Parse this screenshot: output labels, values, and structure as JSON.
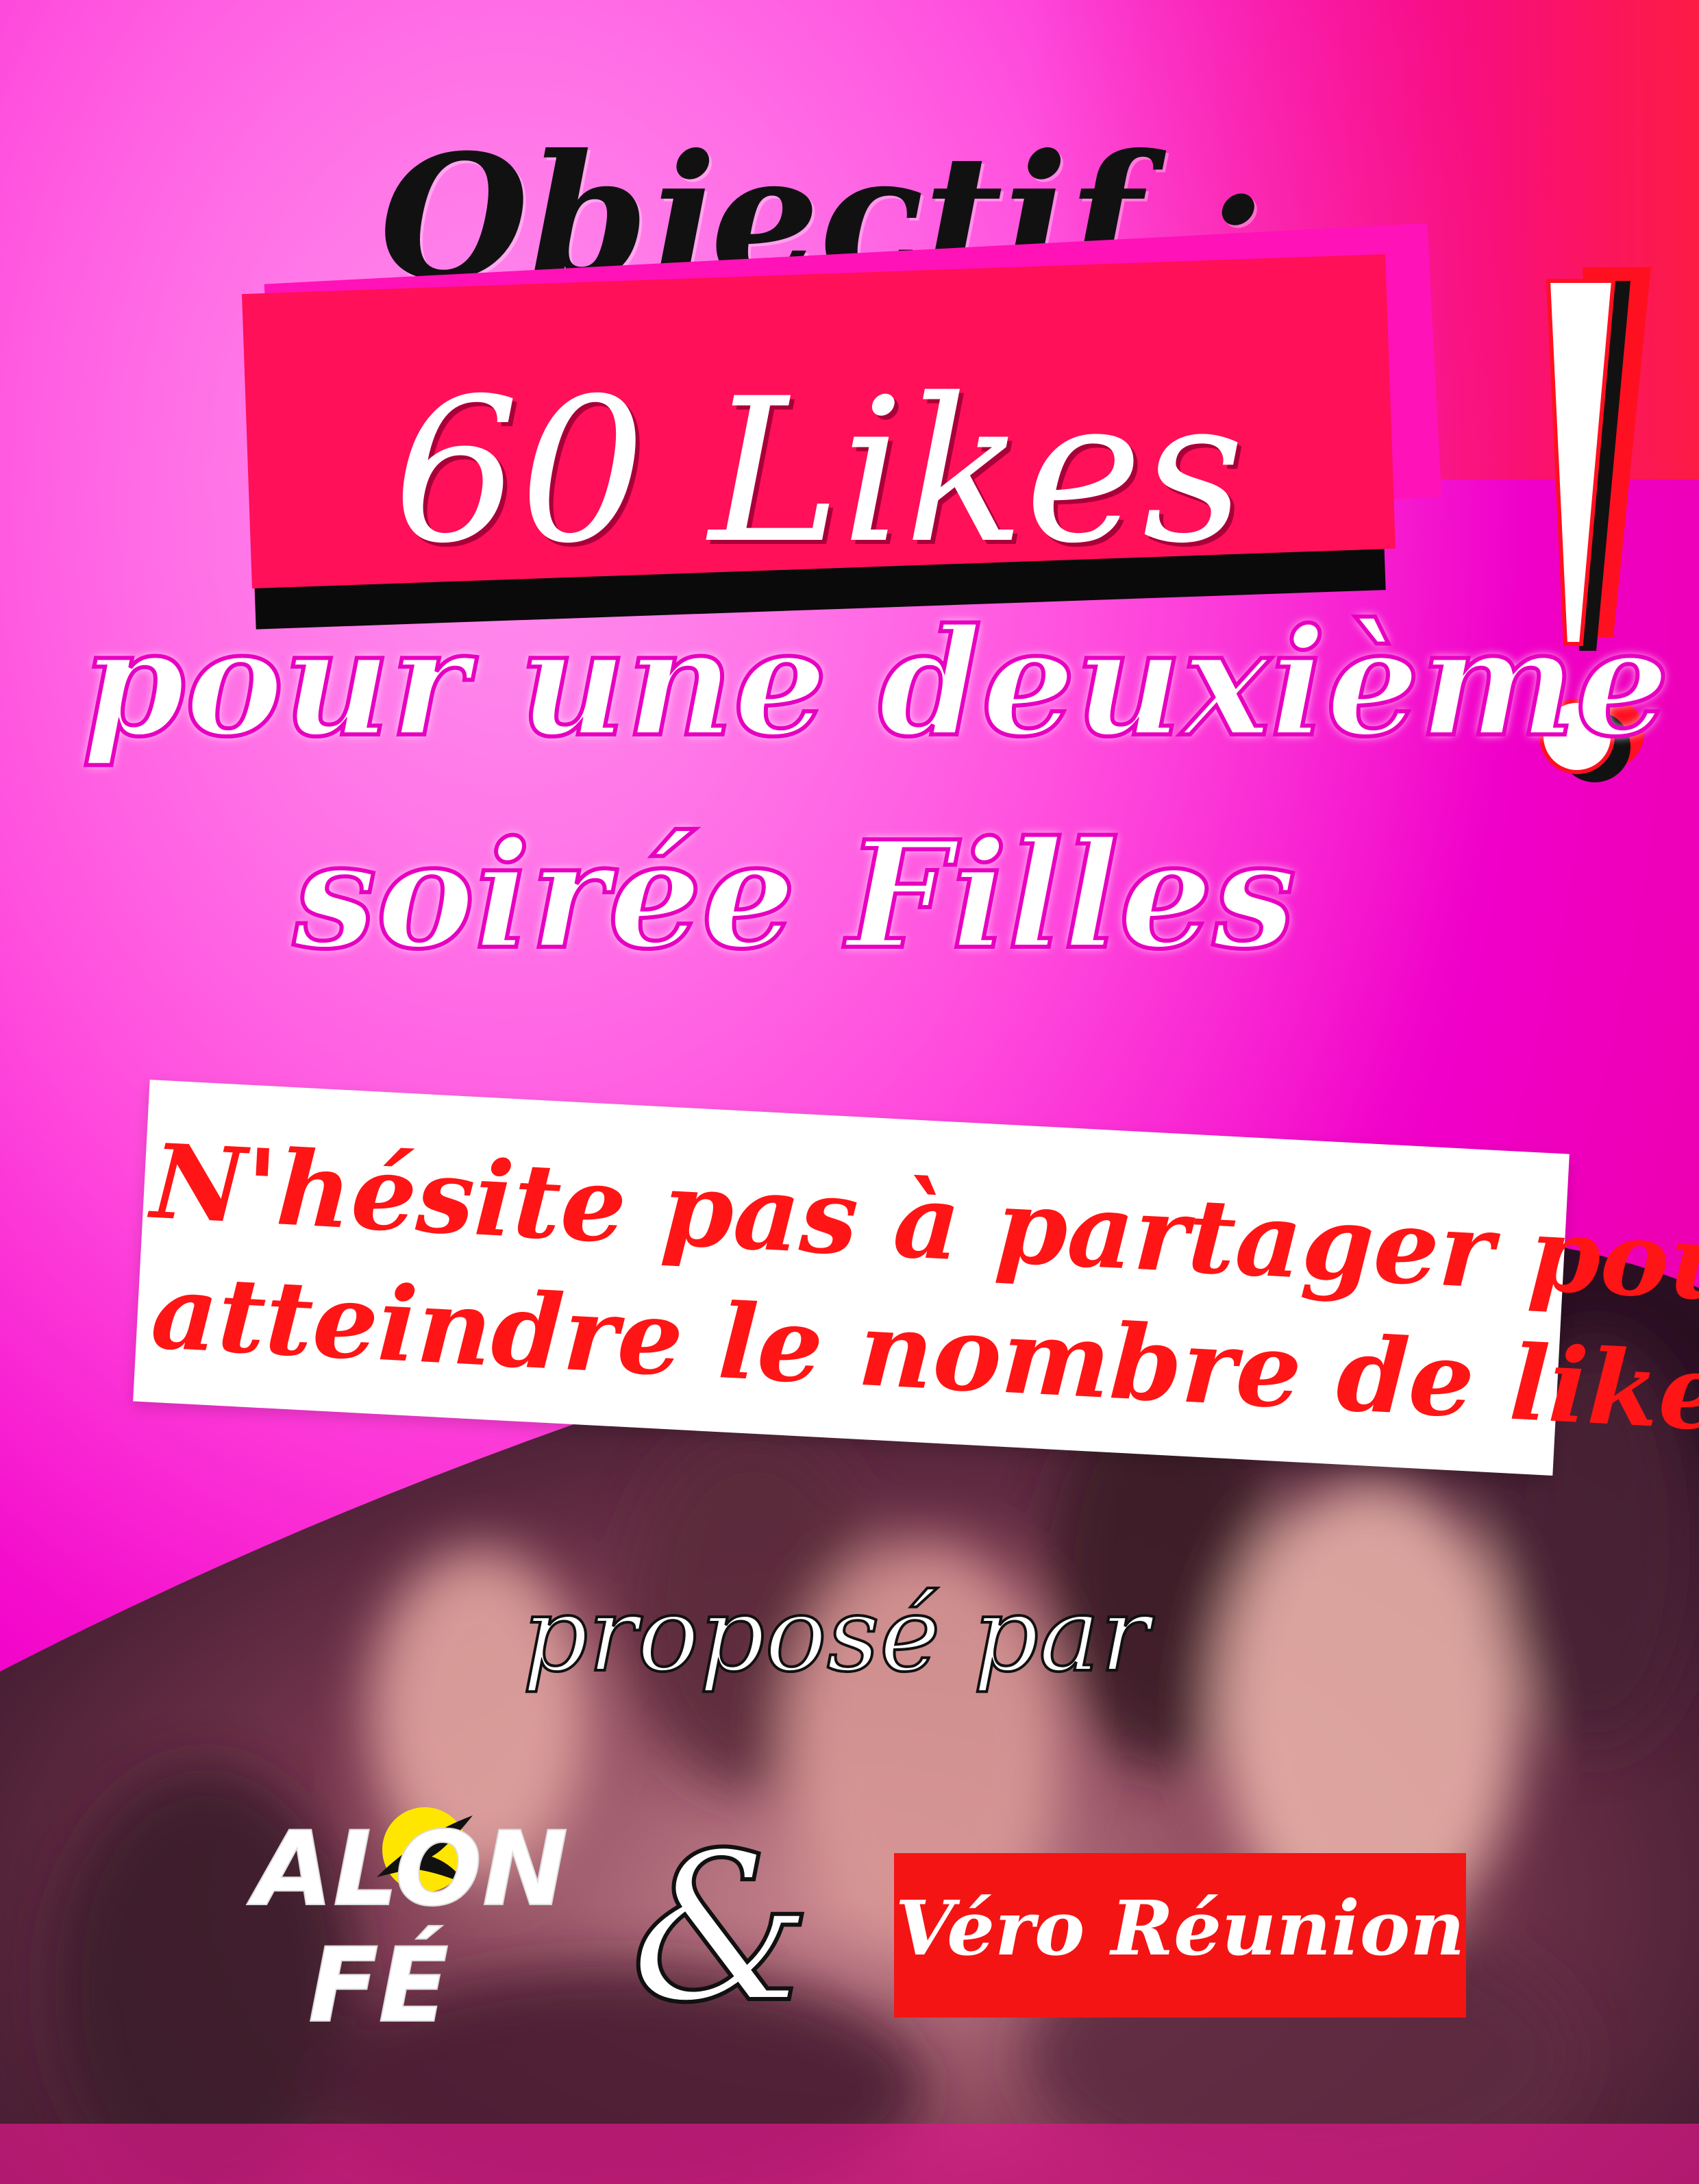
{
  "poster": {
    "headline": "Objectif :",
    "likes_goal": "60 Likes",
    "subtitle_line1": "pour une deuxième",
    "subtitle_line2": "soirée Filles",
    "exclamation": "!",
    "share_line1": "N'hésite pas à partager pour",
    "share_line2": "atteindre le nombre de likes",
    "proposed_by": "proposé par",
    "partner1_logo_text_line1": "ALON",
    "partner1_logo_text_line2": "FÉ",
    "ampersand": "&",
    "partner2": "Véro Réunion"
  },
  "colors": {
    "pink_bg": "#f000c8",
    "red_box": "#ff1058",
    "share_text": "#ff1515",
    "badge_red": "#f41414",
    "logo_yellow": "#ffe600"
  },
  "icons": {
    "logo_bird": "swallow-bird-icon"
  }
}
